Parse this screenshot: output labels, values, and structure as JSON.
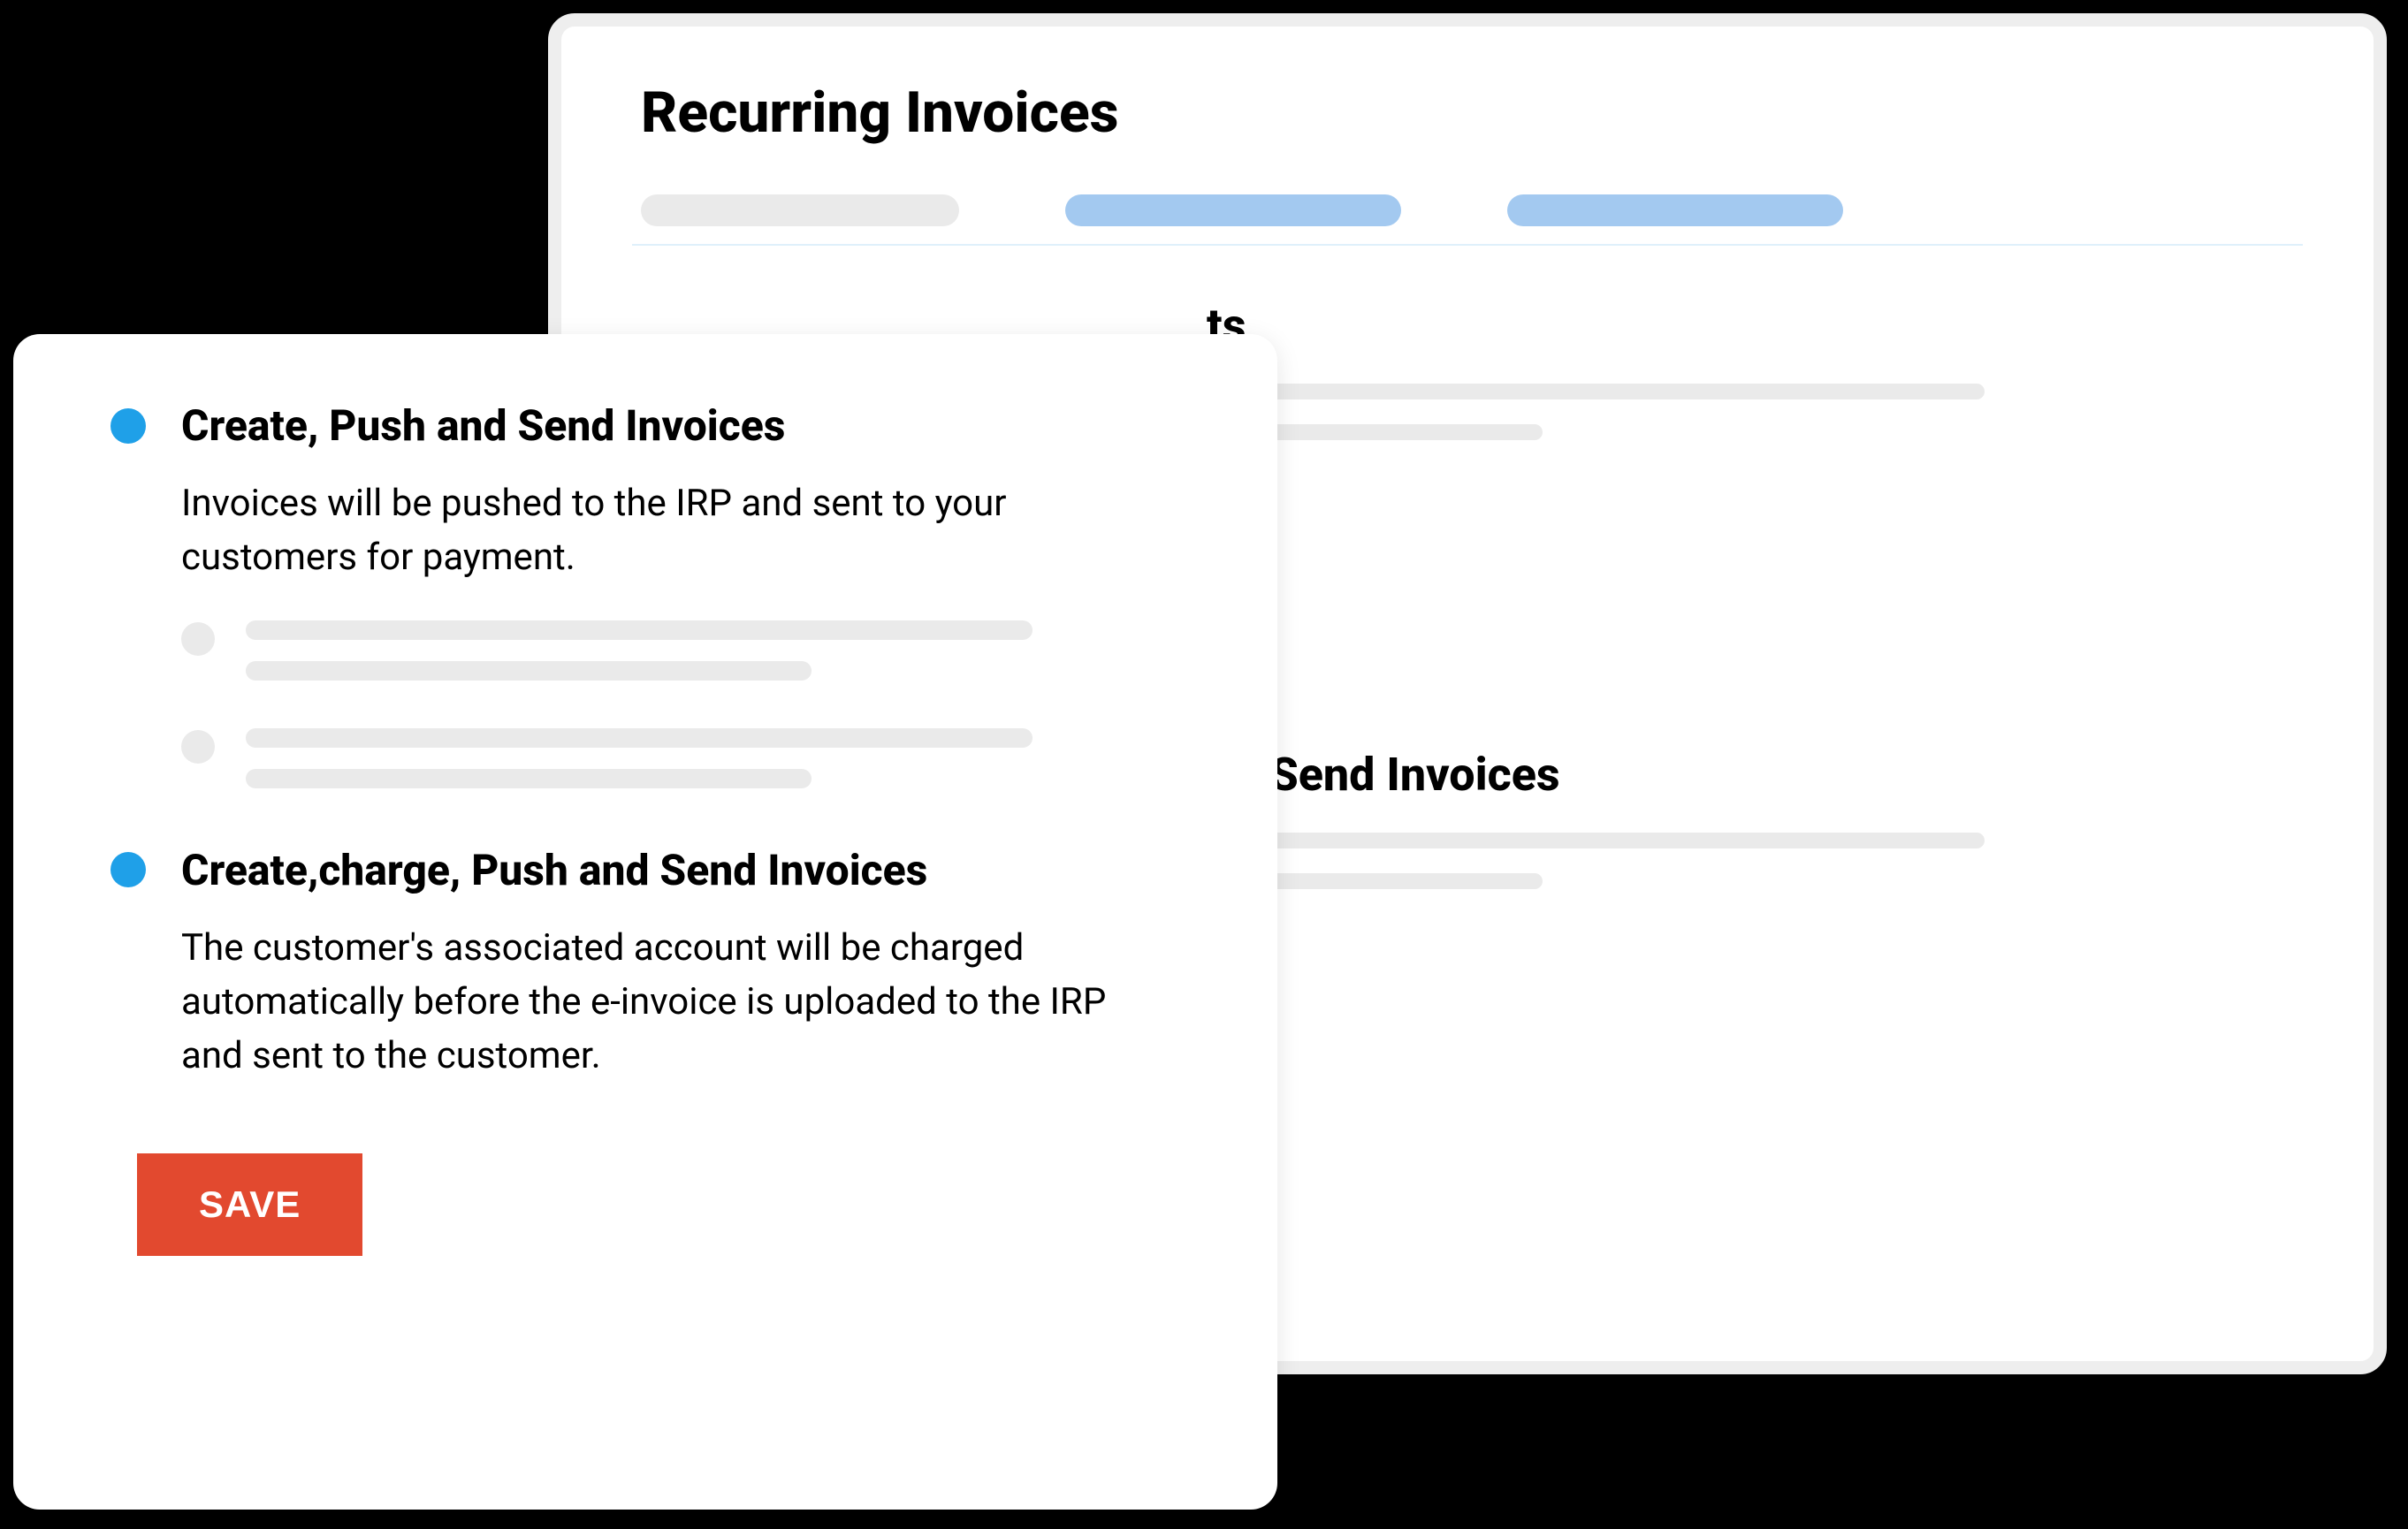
{
  "back_card": {
    "title": "Recurring Invoices",
    "section1_title_suffix": "ts",
    "section2_title": "nd Send Invoices"
  },
  "front_card": {
    "options": [
      {
        "title": "Create, Push and Send Invoices",
        "description": "Invoices will be pushed to the IRP and sent to your customers for payment."
      },
      {
        "title": "Create,charge, Push and Send Invoices",
        "description": "The customer's associated account will be charged automatically before the e-invoice is uploaded to the IRP and sent to the customer."
      }
    ],
    "save_label": "SAVE"
  },
  "colors": {
    "accent_blue": "#1fa0e8",
    "button_red": "#e2492f",
    "pill_blue": "#a3c9f0",
    "placeholder_grey": "#eaeaea"
  }
}
